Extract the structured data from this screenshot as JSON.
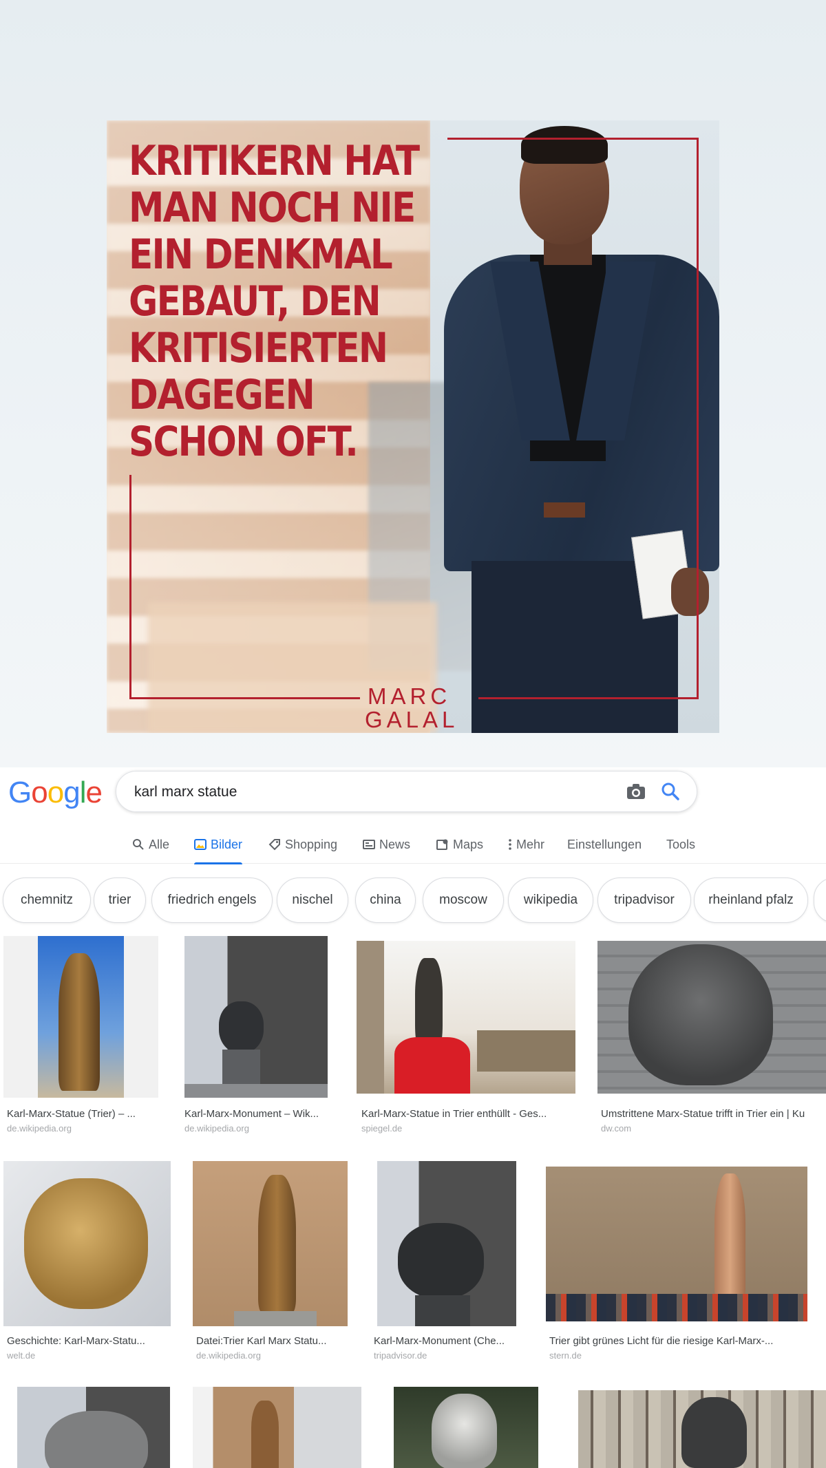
{
  "poster": {
    "quote_lines": [
      "KRITIKERN HAT",
      "MAN NOCH NIE",
      "EIN DENKMAL",
      "GEBAUT, DEN",
      "KRITISIERTEN",
      "DAGEGEN",
      "SCHON OFT."
    ],
    "brand_line1": "MARC",
    "brand_line2": "GALAL",
    "accent_color": "#b3202e"
  },
  "google": {
    "logo_letters": [
      "G",
      "o",
      "o",
      "g",
      "l",
      "e"
    ],
    "logo_colors": [
      "#4285f4",
      "#ea4335",
      "#fbbc05",
      "#4285f4",
      "#34a853",
      "#ea4335"
    ],
    "search_value": "karl marx statue",
    "camera_icon": "camera-icon",
    "search_icon": "search-icon",
    "tabs": [
      {
        "label": "Alle",
        "icon": "search-icon",
        "active": false
      },
      {
        "label": "Bilder",
        "icon": "image-icon",
        "active": true
      },
      {
        "label": "Shopping",
        "icon": "tag-icon",
        "active": false
      },
      {
        "label": "News",
        "icon": "newspaper-icon",
        "active": false
      },
      {
        "label": "Maps",
        "icon": "map-icon",
        "active": false
      },
      {
        "label": "Mehr",
        "icon": "more-vert-icon",
        "active": false
      },
      {
        "label": "Einstellungen",
        "icon": "",
        "active": false
      },
      {
        "label": "Tools",
        "icon": "",
        "active": false
      }
    ],
    "chips": [
      "chemnitz",
      "trier",
      "friedrich engels",
      "nischel",
      "china",
      "moscow",
      "wikipedia",
      "tripadvisor",
      "rheinland pfalz"
    ],
    "results": [
      {
        "title": "Karl-Marx-Statue (Trier) – ...",
        "source": "de.wikipedia.org"
      },
      {
        "title": "Karl-Marx-Monument – Wik...",
        "source": "de.wikipedia.org"
      },
      {
        "title": "Karl-Marx-Statue in Trier enthüllt - Ges...",
        "source": "spiegel.de"
      },
      {
        "title": "Umstrittene Marx-Statue trifft in Trier ein | Ku",
        "source": "dw.com"
      },
      {
        "title": "Geschichte: Karl-Marx-Statu...",
        "source": "welt.de"
      },
      {
        "title": "Datei:Trier Karl Marx Statu...",
        "source": "de.wikipedia.org"
      },
      {
        "title": "Karl-Marx-Monument (Che...",
        "source": "tripadvisor.de"
      },
      {
        "title": "Trier gibt grünes Licht für die riesige Karl-Marx-...",
        "source": "stern.de"
      },
      {
        "title": "",
        "source": ""
      },
      {
        "title": "",
        "source": ""
      },
      {
        "title": "",
        "source": ""
      },
      {
        "title": "",
        "source": ""
      }
    ]
  }
}
